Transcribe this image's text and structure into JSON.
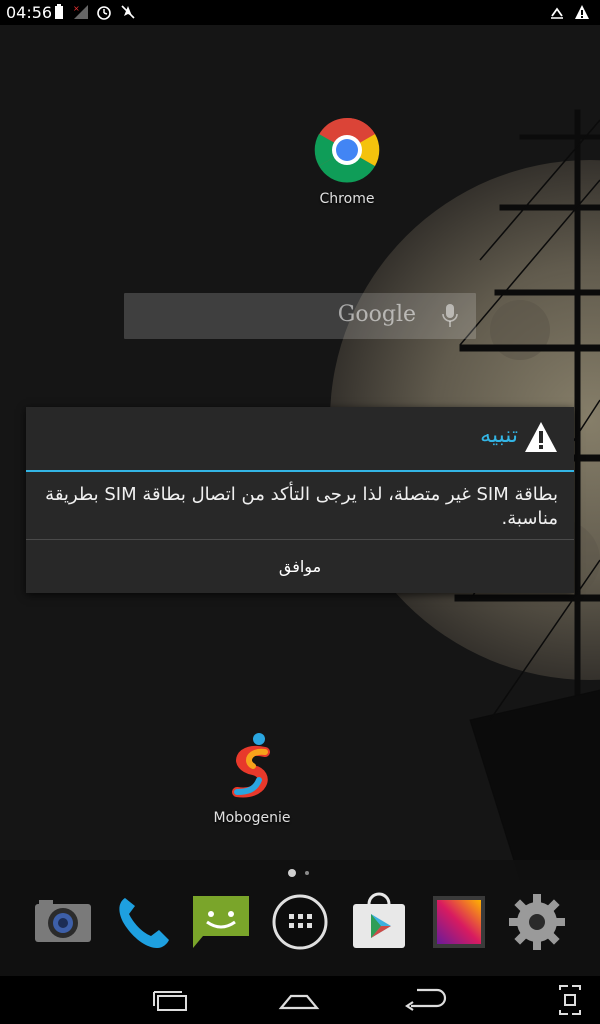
{
  "status_bar": {
    "time": "04:56",
    "icons": [
      "battery-icon",
      "no-signal-icon",
      "alarm-icon",
      "no-gps-icon",
      "usb-debug-icon",
      "warning-icon"
    ]
  },
  "home": {
    "chrome_label": "Chrome",
    "mobogenie_label": "Mobogenie",
    "search_placeholder": "Google"
  },
  "dialog": {
    "title": "تنبيه",
    "message": "بطاقة SIM غير متصلة، لذا يرجى التأكد من اتصال بطاقة SIM بطريقة مناسبة.",
    "ok_label": "موافق"
  },
  "dock": [
    "camera-icon",
    "phone-icon",
    "messaging-icon",
    "all-apps-icon",
    "play-store-icon",
    "gallery-icon",
    "settings-icon"
  ],
  "nav": [
    "recent-apps-icon",
    "home-icon",
    "back-icon",
    "screenshot-icon"
  ],
  "colors": {
    "accent": "#33b5e5",
    "dialog_bg": "#282828"
  }
}
